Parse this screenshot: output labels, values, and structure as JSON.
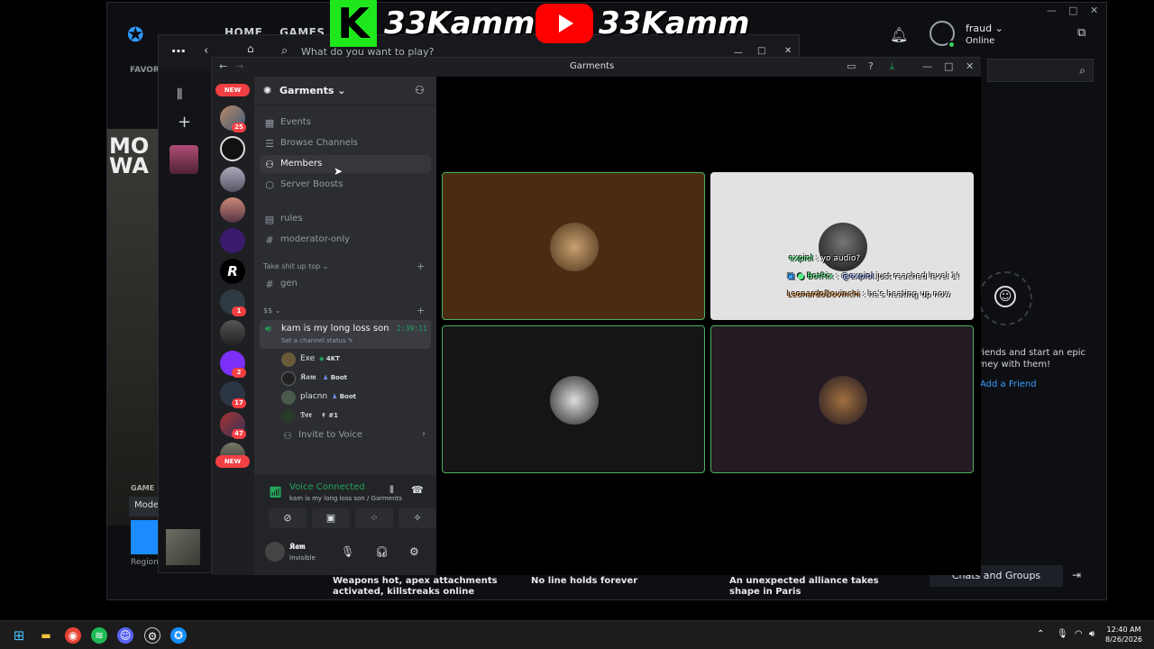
{
  "battlenet": {
    "nav": [
      "HOME",
      "GAMES"
    ],
    "favorites_label": "FAVOR",
    "game_title_art": [
      "MO",
      "WA"
    ],
    "game_label": "GAME",
    "mode_label": "Mode",
    "region_label": "Region:",
    "user": {
      "name": "fraud",
      "status": "Online"
    },
    "friends_text": "riends and start an epic rney with them!",
    "add_friend": "Add a Friend",
    "chats_groups": "Chats and Groups",
    "news": [
      "Weapons hot, apex attachments activated, killstreaks online",
      "No line holds forever",
      "An unexpected alliance takes shape in Paris"
    ]
  },
  "launcher": {
    "search_placeholder": "What do you want to play?"
  },
  "banner": {
    "left_text": "33Kamm",
    "right_text": "33Kamm",
    "k_letter": "K"
  },
  "discord": {
    "window_title": "Garments",
    "guild_badges": [
      "NEW",
      "25",
      "1",
      "2",
      "17",
      "47",
      "NEW"
    ],
    "server": {
      "name": "Garments",
      "top_items": [
        {
          "icon": "calendar-icon",
          "label": "Events"
        },
        {
          "icon": "browse-icon",
          "label": "Browse Channels"
        },
        {
          "icon": "members-icon",
          "label": "Members"
        },
        {
          "icon": "boost-icon",
          "label": "Server Boosts"
        }
      ],
      "channels": [
        {
          "icon": "rules-icon",
          "label": "rules"
        },
        {
          "icon": "hash-icon",
          "label": "moderator-only"
        }
      ],
      "category1": "Take shit up top",
      "category1_channel": "gen",
      "category2": "$$",
      "voice_channel": {
        "name": "kam is my long loss son",
        "timer": "2:39:11",
        "status": "Set a channel status"
      },
      "voice_users": [
        {
          "name": "Exe",
          "tag": "4KT",
          "color": "#23a55a"
        },
        {
          "name": "𝕶𝖆𝖒",
          "tag": "Boot",
          "color": "#7289da"
        },
        {
          "name": "placnn",
          "tag": "Boot",
          "color": "#7289da"
        },
        {
          "name": "𝕯𝖊𝖊",
          "tag": "#1",
          "color": "#dbdee1"
        }
      ],
      "invite_voice": "Invite to Voice"
    },
    "voice_panel": {
      "title": "Voice Connected",
      "subtitle": "kam is my long loss son / Garments"
    },
    "user_panel": {
      "name": "𝕶𝖆𝖒",
      "status": "Invisible"
    },
    "chat_overlay": [
      {
        "user": "expiol",
        "text": "yo audio?",
        "user_color": "#57f287"
      },
      {
        "user": "BotRix",
        "mention": "@expiol",
        "text": "just reached level 1!",
        "user_color": "#57f287"
      },
      {
        "user": "LeonardoDovinchi",
        "text": "he's heating up now",
        "user_color": "#f0a050"
      }
    ]
  },
  "taskbar": {
    "time": "12:40 AM",
    "date": "8/26/2026"
  },
  "colors": {
    "accent_green": "#23a55a",
    "tile_border": "#4bb05f",
    "badge_red": "#f23f43",
    "bnet_blue": "#2f9bff"
  }
}
